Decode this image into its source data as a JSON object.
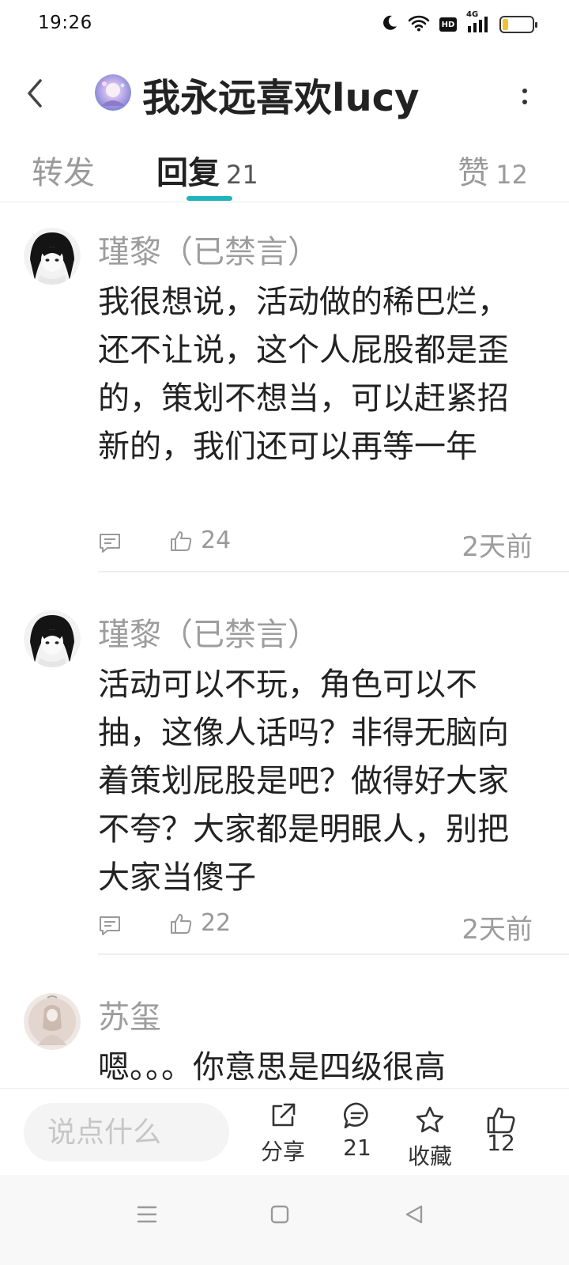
{
  "status_bar": {
    "time": "19:26",
    "hd_label": "HD",
    "network_label": "4G",
    "battery_level": 0.2,
    "icons": [
      "moon-icon",
      "wifi-icon",
      "signal-icon",
      "battery-icon"
    ]
  },
  "header": {
    "title": "我永远喜欢lucy",
    "icons": [
      "back-arrow-icon",
      "more-vertical-icon"
    ]
  },
  "tabs": [
    {
      "label": "转发",
      "count": ""
    },
    {
      "label": "回复",
      "count": "21"
    },
    {
      "label": "赞",
      "count": "12"
    }
  ],
  "accent_color": "#1fb3bc",
  "comments": [
    {
      "author": "瑾黎（已禁言）",
      "text": "我很想说，活动做的稀巴烂，还不让说，这个人屁股都是歪的，策划不想当，可以赶紧招新的，我们还可以再等一年",
      "likes": "24",
      "time": "2天前"
    },
    {
      "author": "瑾黎（已禁言）",
      "text": "活动可以不玩，角色可以不抽，这像人话吗？非得无脑向着策划屁股是吧？做得好大家不夸？大家都是明眼人，别把大家当傻子",
      "likes": "22",
      "time": "2天前"
    },
    {
      "author": "苏玺",
      "text": "嗯。。。你意思是四级很高"
    }
  ],
  "bottom_bar": {
    "input_placeholder": "说点什么",
    "share_label": "分享",
    "comment_count": "21",
    "favorite_label": "收藏",
    "like_count": "12"
  },
  "nav_bar": {
    "icons": [
      "menu-icon",
      "home-square-icon",
      "back-triangle-icon"
    ]
  }
}
